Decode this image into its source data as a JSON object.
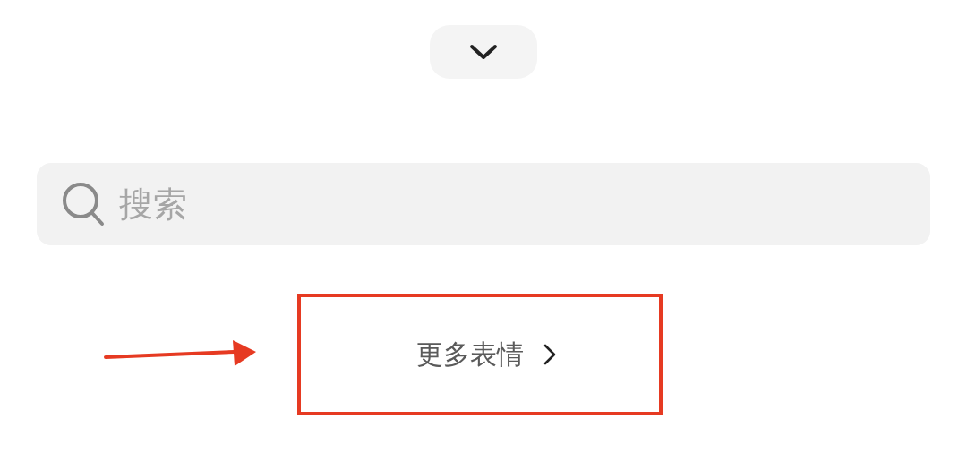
{
  "search": {
    "placeholder": "搜索"
  },
  "more_link": {
    "label": "更多表情"
  }
}
